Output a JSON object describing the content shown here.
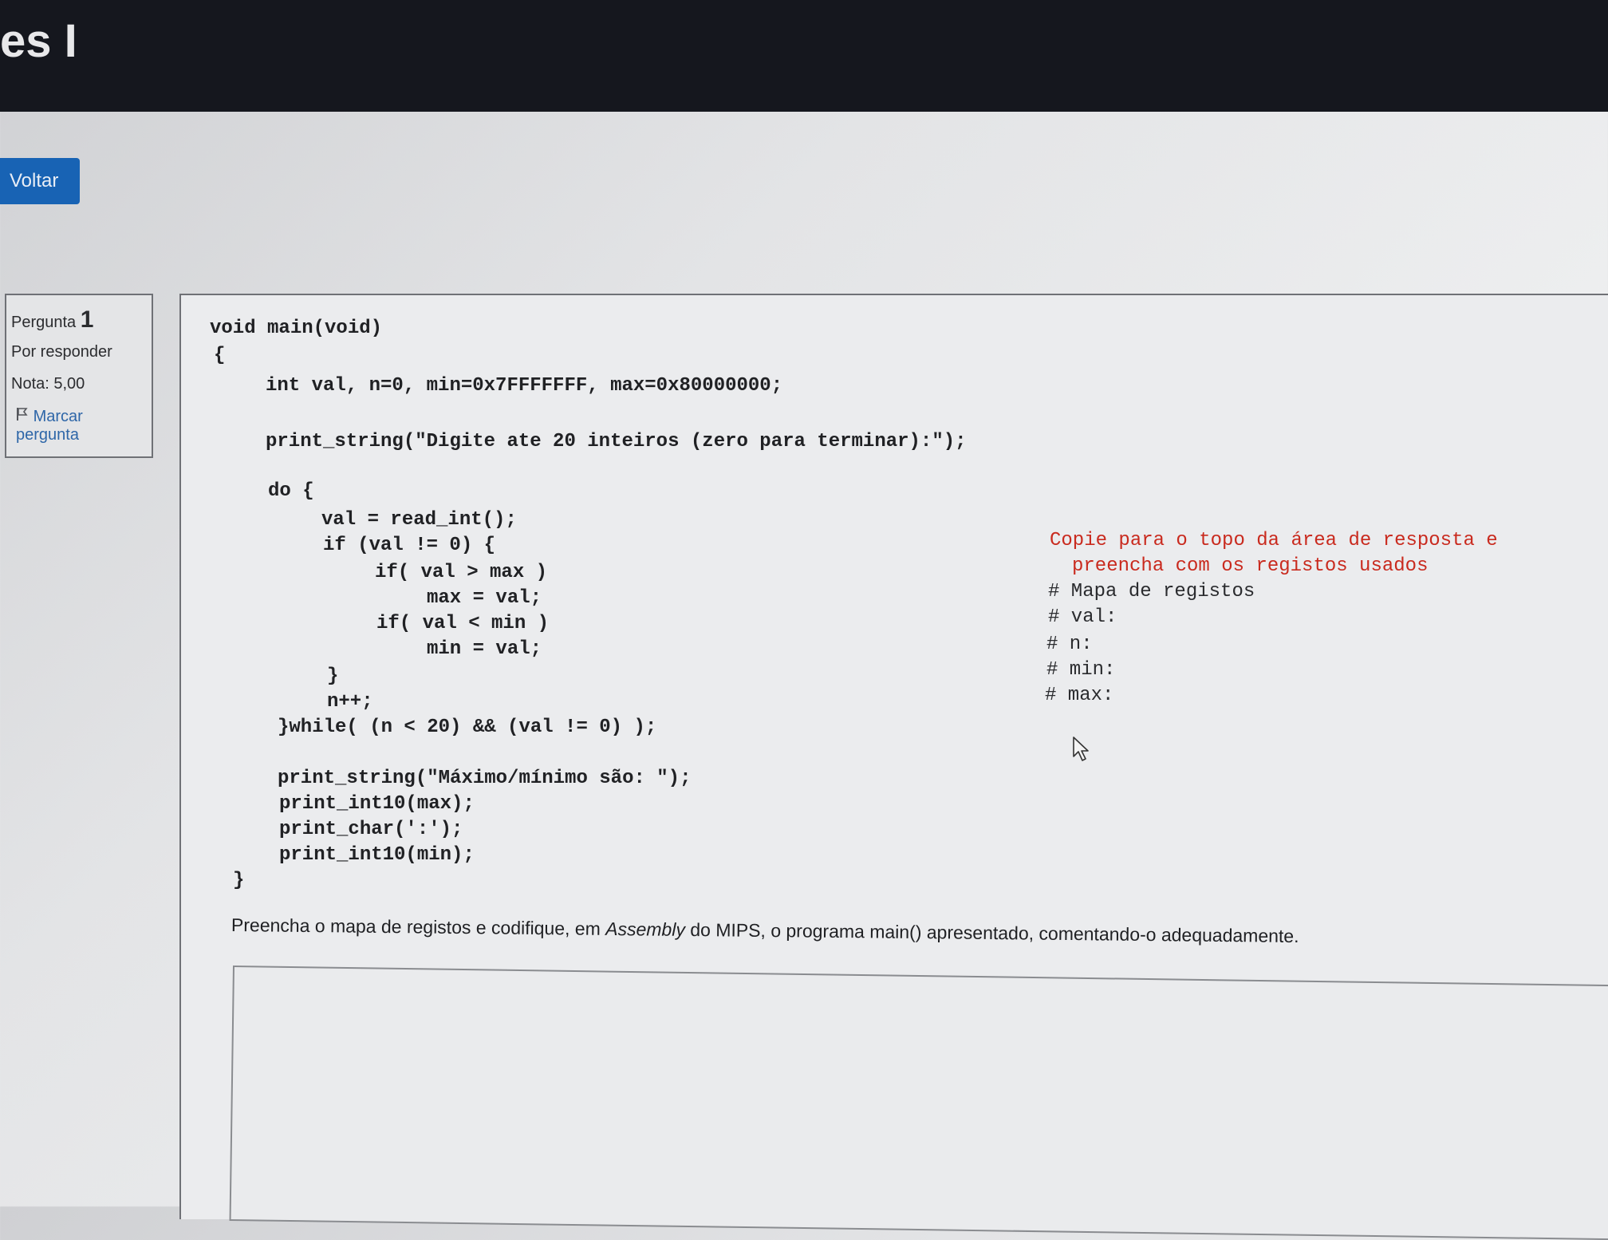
{
  "header": {
    "title_fragment": "es I"
  },
  "nav": {
    "back_label": "Voltar"
  },
  "question_info": {
    "question_label": "Pergunta",
    "question_number": "1",
    "status": "Por responder",
    "grade": "Nota: 5,00",
    "flag_label_line1": "Marcar",
    "flag_label_line2": "pergunta"
  },
  "code_lines": [
    "void main(void)",
    "{",
    "int val, n=0, min=0x7FFFFFFF, max=0x80000000;",
    "print_string(\"Digite ate 20 inteiros (zero para terminar):\");",
    "do {",
    "val = read_int();",
    "if (val != 0) {",
    "if( val > max )",
    "max = val;",
    "if( val < min )",
    "min = val;",
    "}",
    "n++;",
    "}while( (n < 20) && (val != 0) );",
    "print_string(\"Máximo/mínimo são: \");",
    "print_int10(max);",
    "print_char(':');",
    "print_int10(min);",
    "}"
  ],
  "register_comment": {
    "instruction_line1": "Copie para o topo da área de resposta e",
    "instruction_line2": "preencha com os registos usados",
    "map_title": "# Mapa de registos",
    "entries": [
      "# val:",
      "# n:",
      "# min:",
      "# max:"
    ]
  },
  "question_text": {
    "before": "Preencha o mapa de registos e codifique, em ",
    "emphasis": "Assembly",
    "after": " do MIPS, o  programa main() apresentado, comentando-o adequadamente."
  }
}
